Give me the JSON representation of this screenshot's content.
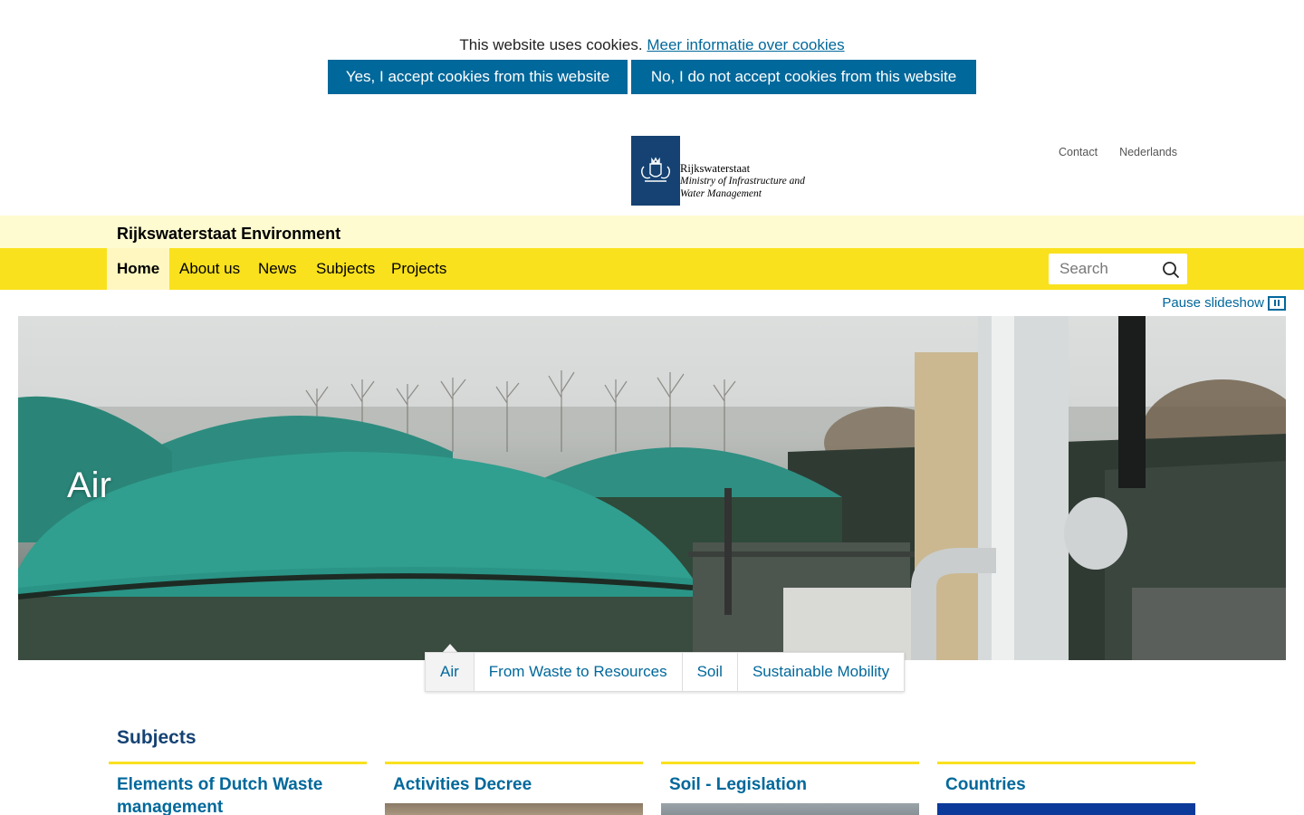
{
  "cookie": {
    "message": "This website uses cookies.",
    "more_info": "Meer informatie over cookies",
    "accept": "Yes, I accept cookies from this website",
    "decline": "No, I do not accept cookies from this website"
  },
  "logo": {
    "line1": "Rijkswaterstaat",
    "line2": "Ministry of Infrastructure and",
    "line3": "Water Management"
  },
  "top_links": [
    "Contact",
    "Nederlands"
  ],
  "site_title": "Rijkswaterstaat Environment",
  "nav": {
    "items": [
      "Home",
      "About us",
      "News",
      "Subjects",
      "Projects"
    ],
    "active": "Home"
  },
  "search": {
    "placeholder": "Search"
  },
  "slideshow": {
    "pause_label": "Pause slideshow",
    "current_title": "Air",
    "tabs": [
      "Air",
      "From Waste to Resources",
      "Soil",
      "Sustainable Mobility"
    ]
  },
  "subjects": {
    "heading": "Subjects",
    "cards": [
      {
        "title": "Elements of Dutch Waste management"
      },
      {
        "title": "Activities Decree"
      },
      {
        "title": "Soil - Legislation"
      },
      {
        "title": "Countries"
      }
    ]
  },
  "colors": {
    "brand_blue": "#01689b",
    "dark_blue": "#154273",
    "yellow": "#f9e11e",
    "light_yellow": "#fffbd0"
  }
}
